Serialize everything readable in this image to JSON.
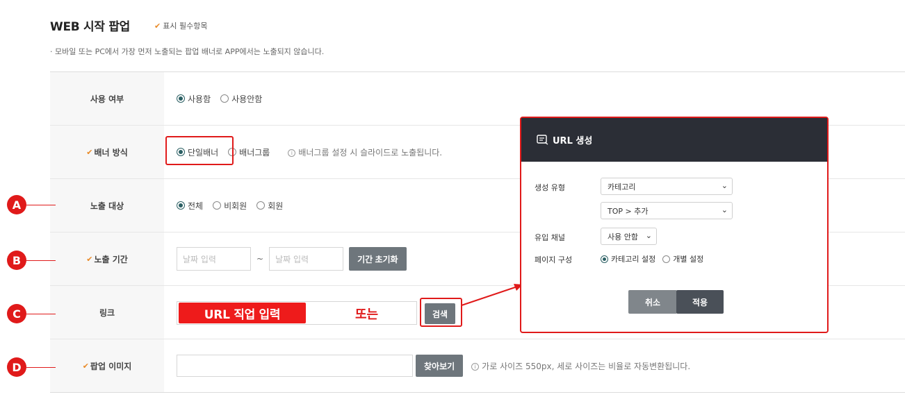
{
  "header": {
    "title": "WEB 시작 팝업",
    "required_mark": "✔",
    "required_note": "표시 필수항목",
    "notice": "· 모바일 또는 PC에서 가장 먼저 노출되는 팝업 배너로 APP에서는 노출되지 않습니다."
  },
  "rows": {
    "usage": {
      "label": "사용 여부",
      "options": [
        "사용함",
        "사용안함"
      ],
      "selected": "사용함"
    },
    "banner_type": {
      "label": "배너 방식",
      "options": [
        "단일배너",
        "배너그룹"
      ],
      "selected": "단일배너",
      "hint": "배너그룹 설정 시 슬라이드로 노출됩니다."
    },
    "target": {
      "label": "노출 대상",
      "options": [
        "전체",
        "비회원",
        "회원"
      ],
      "selected": "전체"
    },
    "period": {
      "label": "노출 기간",
      "start_placeholder": "날짜 입력",
      "separator": "~",
      "end_placeholder": "날짜 입력",
      "reset_button": "기간 초기화"
    },
    "link": {
      "label": "링크",
      "overlay_label": "URL 직업 입력",
      "or_text": "또는",
      "search_button": "검색"
    },
    "image": {
      "label": "팝업 이미지",
      "browse_button": "찾아보기",
      "hint": "가로 사이즈 550px, 세로 사이즈는 비율로 자동변환됩니다."
    }
  },
  "badges": [
    "A",
    "B",
    "C",
    "D"
  ],
  "modal": {
    "icon": "url-icon",
    "title": "URL 생성",
    "type_label": "생성 유형",
    "type_value": "카테고리",
    "category_value": "TOP > 추가",
    "channel_label": "유입 채널",
    "channel_value": "사용 안함",
    "page_label": "페이지 구성",
    "page_options": [
      "카테고리 설정",
      "개별 설정"
    ],
    "page_selected": "카테고리 설정",
    "cancel_button": "취소",
    "apply_button": "적용"
  },
  "colors": {
    "accent_red": "#e01a1a",
    "check_orange": "#e98a27",
    "radio_selected": "#2b5f63",
    "modal_header": "#2b2e36"
  }
}
